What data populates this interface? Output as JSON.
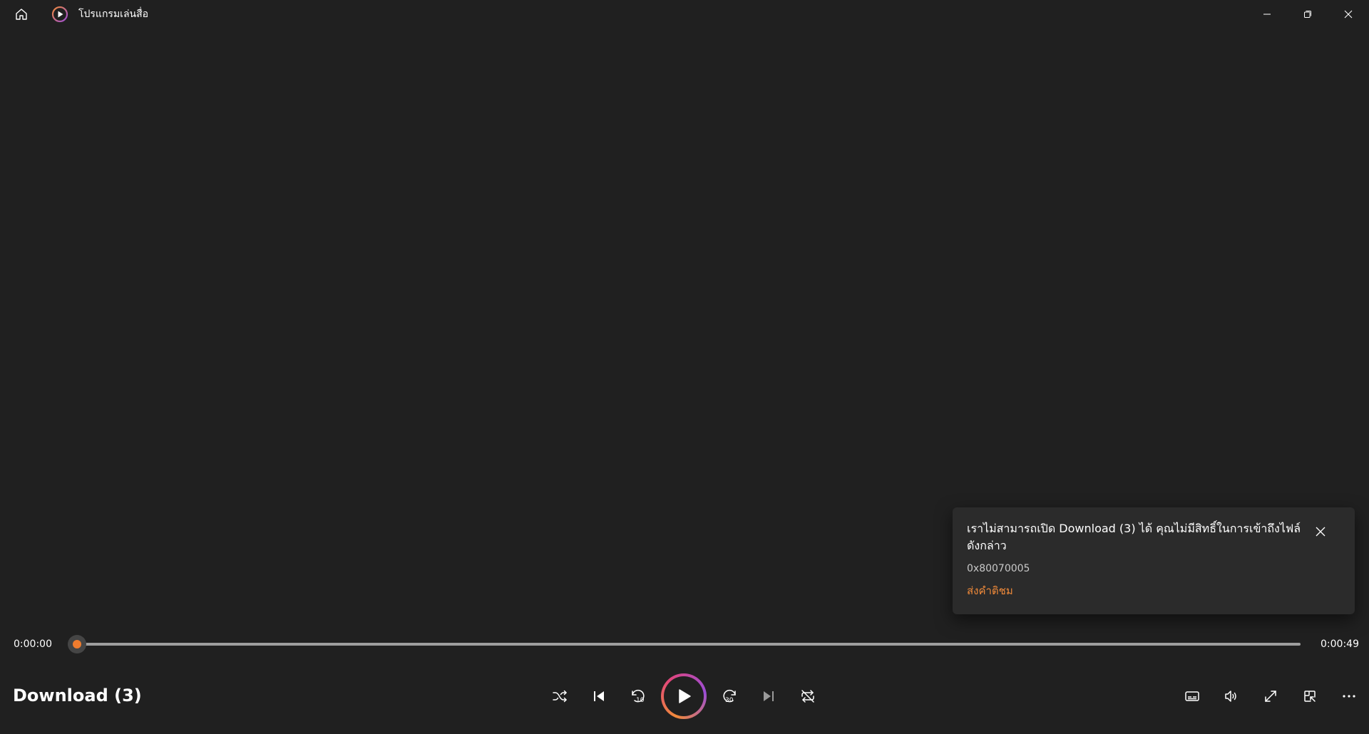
{
  "titlebar": {
    "app_title": "โปรแกรมเล่นสื่อ",
    "icons": {
      "home": "home-icon",
      "logo": "media-player-logo",
      "minimize": "minimize-icon",
      "maximize": "restore-icon",
      "close": "close-icon"
    }
  },
  "toast": {
    "message": "เราไม่สามารถเปิด Download (3) ได้ คุณไม่มีสิทธิ์ในการเข้าถึงไฟล์ดังกล่าว",
    "error_code": "0x80070005",
    "link_label": "ส่งคำติชม",
    "link_color": "#f08a3a"
  },
  "player": {
    "time_current": "0:00:00",
    "time_total": "0:00:49",
    "progress": 0,
    "media_title": "Download (3)",
    "accent": "#f07c2e",
    "controls": [
      "shuffle-icon",
      "previous-icon",
      "skip-back-10-icon",
      "play-icon",
      "skip-forward-30-icon",
      "next-icon",
      "repeat-off-icon"
    ],
    "right_controls": [
      "subtitles-icon",
      "volume-icon",
      "fullscreen-icon",
      "mini-player-icon",
      "more-icon"
    ]
  }
}
